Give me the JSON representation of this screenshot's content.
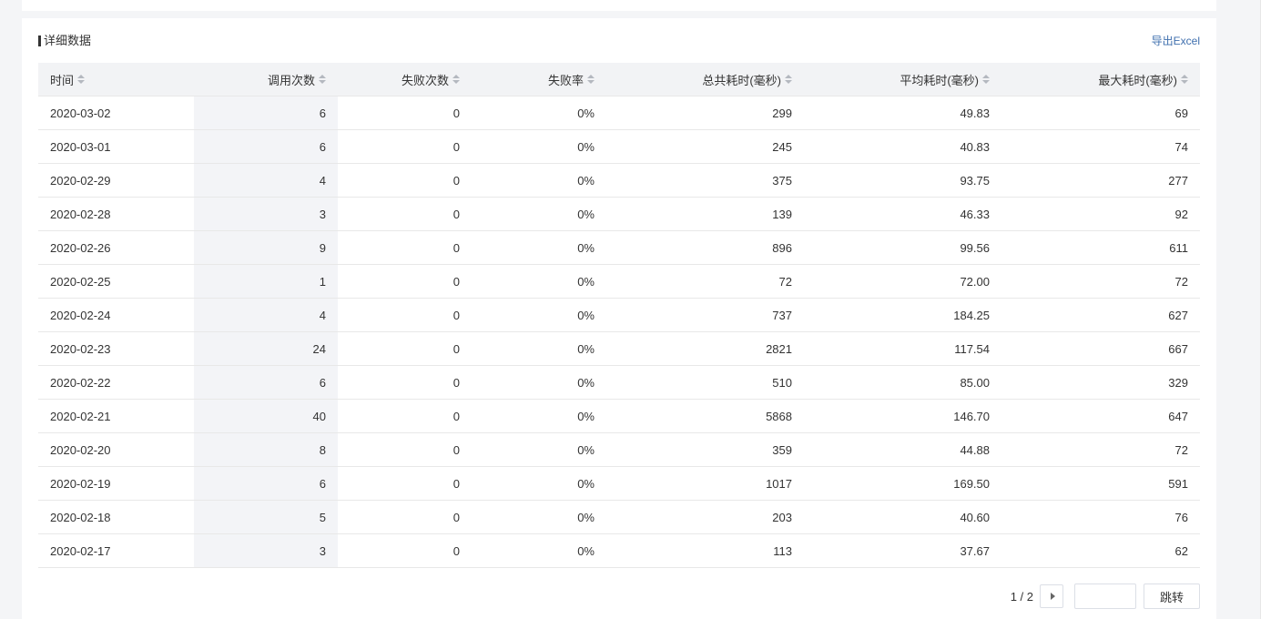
{
  "section": {
    "title": "详细数据",
    "export_label": "导出Excel"
  },
  "table": {
    "columns": [
      "时间",
      "调用次数",
      "失败次数",
      "失败率",
      "总共耗时(毫秒)",
      "平均耗时(毫秒)",
      "最大耗时(毫秒)"
    ],
    "rows": [
      [
        "2020-03-02",
        "6",
        "0",
        "0%",
        "299",
        "49.83",
        "69"
      ],
      [
        "2020-03-01",
        "6",
        "0",
        "0%",
        "245",
        "40.83",
        "74"
      ],
      [
        "2020-02-29",
        "4",
        "0",
        "0%",
        "375",
        "93.75",
        "277"
      ],
      [
        "2020-02-28",
        "3",
        "0",
        "0%",
        "139",
        "46.33",
        "92"
      ],
      [
        "2020-02-26",
        "9",
        "0",
        "0%",
        "896",
        "99.56",
        "611"
      ],
      [
        "2020-02-25",
        "1",
        "0",
        "0%",
        "72",
        "72.00",
        "72"
      ],
      [
        "2020-02-24",
        "4",
        "0",
        "0%",
        "737",
        "184.25",
        "627"
      ],
      [
        "2020-02-23",
        "24",
        "0",
        "0%",
        "2821",
        "117.54",
        "667"
      ],
      [
        "2020-02-22",
        "6",
        "0",
        "0%",
        "510",
        "85.00",
        "329"
      ],
      [
        "2020-02-21",
        "40",
        "0",
        "0%",
        "5868",
        "146.70",
        "647"
      ],
      [
        "2020-02-20",
        "8",
        "0",
        "0%",
        "359",
        "44.88",
        "72"
      ],
      [
        "2020-02-19",
        "6",
        "0",
        "0%",
        "1017",
        "169.50",
        "591"
      ],
      [
        "2020-02-18",
        "5",
        "0",
        "0%",
        "203",
        "40.60",
        "76"
      ],
      [
        "2020-02-17",
        "3",
        "0",
        "0%",
        "113",
        "37.67",
        "62"
      ]
    ]
  },
  "pagination": {
    "page_info": "1 / 2",
    "jump_label": "跳转",
    "input_value": ""
  },
  "colors": {
    "link": "#3f6fae",
    "header_bg": "#f2f3f5",
    "highlight_col_bg": "#f3f4f7",
    "border": "#e8e8e8"
  },
  "icons": {
    "sort": "sort-icon",
    "next": "chevron-right-icon"
  }
}
